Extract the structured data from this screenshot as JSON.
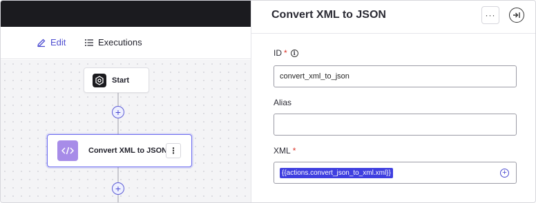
{
  "toolbar": {
    "edit_label": "Edit",
    "executions_label": "Executions"
  },
  "workflow": {
    "start_node_label": "Start",
    "action_node_label": "Convert XML to JSON",
    "action_node_menu": "⋮",
    "add_step_symbol": "+"
  },
  "panel": {
    "title": "Convert XML to JSON",
    "more_button": "···",
    "fields": {
      "id": {
        "label": "ID",
        "required_mark": "*",
        "value": "convert_xml_to_json"
      },
      "alias": {
        "label": "Alias",
        "value": ""
      },
      "xml": {
        "label": "XML",
        "required_mark": "*",
        "token": "{{actions.convert_json_to_xml.xml}}"
      }
    }
  },
  "colors": {
    "accent": "#4a4ad0",
    "node_border": "#6c6cf0",
    "token_bg": "#3f3fe0",
    "topbar": "#1b1b1f",
    "required": "#d93025",
    "action_icon_bg": "#a78ce8"
  },
  "icons": [
    "pencil-icon",
    "list-icon",
    "gear-icon",
    "code-icon",
    "kebab-icon",
    "info-icon",
    "collapse-panel-icon",
    "plus-icon"
  ]
}
